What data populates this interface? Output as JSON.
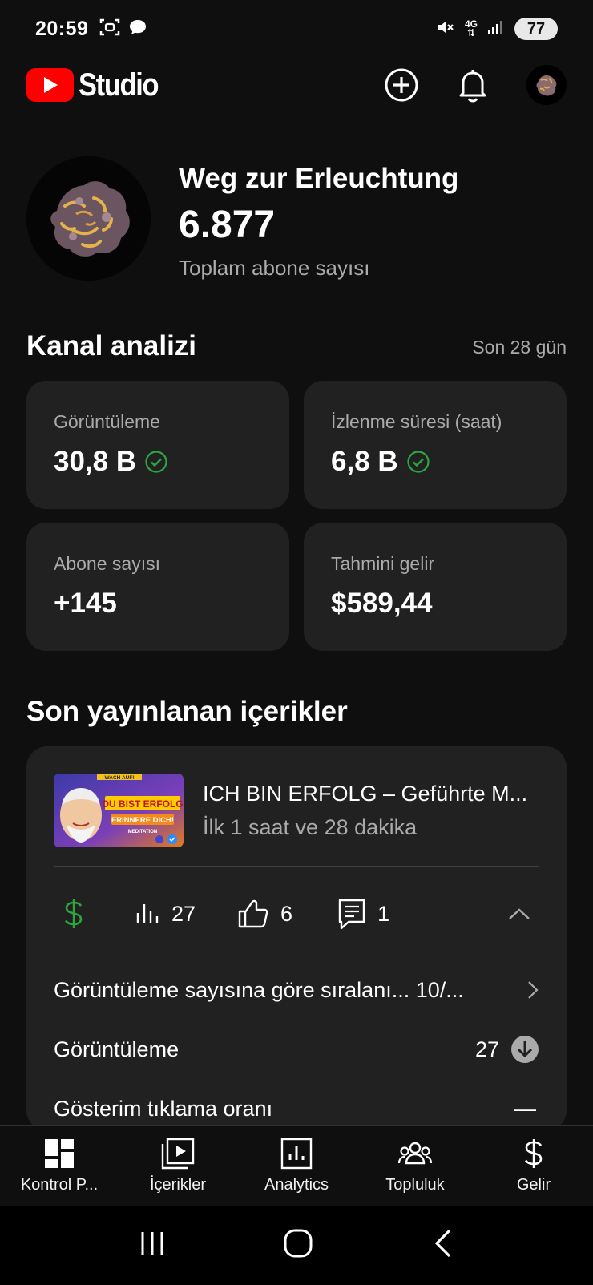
{
  "status_bar": {
    "time": "20:59",
    "network": "4G",
    "battery": "77"
  },
  "header": {
    "brand": "Studio"
  },
  "channel": {
    "name": "Weg zur Erleuchtung",
    "subscribers": "6.877",
    "subscribers_label": "Toplam abone sayısı"
  },
  "analytics": {
    "title": "Kanal analizi",
    "range": "Son 28 gün",
    "cards": [
      {
        "label": "Görüntüleme",
        "value": "30,8 B",
        "verified": true
      },
      {
        "label": "İzlenme süresi (saat)",
        "value": "6,8 B",
        "verified": true
      },
      {
        "label": "Abone sayısı",
        "value": "+145",
        "verified": false
      },
      {
        "label": "Tahmini gelir",
        "value": "$589,44",
        "verified": false
      }
    ]
  },
  "recent": {
    "title": "Son yayınlanan içerikler",
    "video": {
      "title": "ICH BIN ERFOLG – Geführte M...",
      "subtitle": "İlk 1 saat ve 28 dakika",
      "thumbnail_text": {
        "top": "WACH AUF!",
        "main": "DU BIST ERFOLG",
        "second": "ERINNERE DICH!",
        "third": "MEDITATION"
      },
      "metrics": {
        "views": "27",
        "likes": "6",
        "comments": "1"
      },
      "details": [
        {
          "label": "Görüntüleme sayısına göre sıralanı... 10/...",
          "value": ""
        },
        {
          "label": "Görüntüleme",
          "value": "27"
        },
        {
          "label": "Gösterim tıklama oranı",
          "value": "—"
        }
      ]
    }
  },
  "bottom_nav": [
    {
      "label": "Kontrol P...",
      "icon": "dashboard-icon"
    },
    {
      "label": "İçerikler",
      "icon": "content-icon"
    },
    {
      "label": "Analytics",
      "icon": "analytics-icon"
    },
    {
      "label": "Topluluk",
      "icon": "community-icon"
    },
    {
      "label": "Gelir",
      "icon": "dollar-icon"
    }
  ],
  "colors": {
    "accent_red": "#ff0000",
    "success_green": "#2ba640",
    "card_bg": "#212121",
    "bg": "#0f0f0f"
  }
}
